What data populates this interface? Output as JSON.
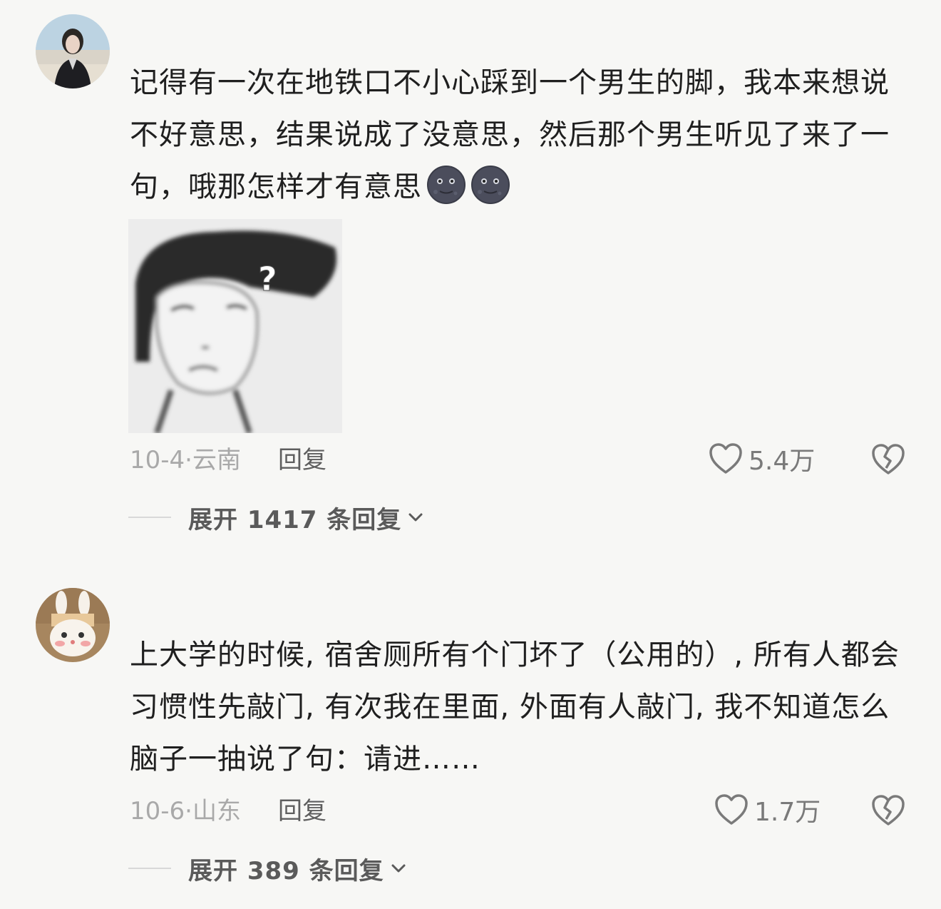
{
  "comments": [
    {
      "avatar_icon": "user-avatar-woman-beach",
      "text": "记得有一次在地铁口不小心踩到一个男生的脚，我本来想说不好意思，结果说成了没意思，然后那个男生听见了来了一句，哦那怎样才有意思",
      "emojis": [
        "moon-face-icon",
        "moon-face-icon"
      ],
      "image_icon": "confused-sketch-meme",
      "date": "10-4·",
      "location": "云南",
      "reply_label": "回复",
      "likes": "5.4万",
      "expand_label": "展开 1417 条回复"
    },
    {
      "avatar_icon": "user-avatar-bunny-plush",
      "text": "上大学的时候, 宿舍厕所有个门坏了（公用的）, 所有人都会习惯性先敲门, 有次我在里面, 外面有人敲门, 我不知道怎么脑子一抽说了句：请进……",
      "date": "10-6·",
      "location": "山东",
      "reply_label": "回复",
      "likes": "1.7万",
      "expand_label": "展开 389 条回复"
    }
  ],
  "colors": {
    "background": "#f7f7f5",
    "text": "#1f1f1f",
    "meta": "#a9a9a9",
    "icon": "#7a7a7a"
  }
}
